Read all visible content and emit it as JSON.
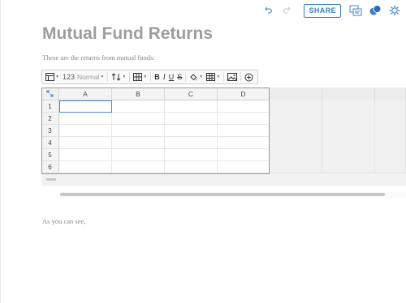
{
  "header": {
    "share_label": "SHARE",
    "icons": [
      "undo-icon",
      "redo-icon",
      "present-icon",
      "comments-icon",
      "settings-icon"
    ]
  },
  "document": {
    "title": "Mutual Fund Returns",
    "intro": "These are the returns from mutual funds:",
    "after_text": "As you can see,"
  },
  "toolbar": {
    "number_format_code": "123",
    "number_format_name": "Normal",
    "bold": "B",
    "italic": "I",
    "underline": "U",
    "strike": "S"
  },
  "spreadsheet": {
    "columns": [
      "A",
      "B",
      "C",
      "D"
    ],
    "rows": [
      "1",
      "2",
      "3",
      "4",
      "5",
      "6"
    ],
    "selected_cell": "A1",
    "colors": {
      "selection": "#4a8ad4",
      "share": "#3b7fc4"
    }
  }
}
